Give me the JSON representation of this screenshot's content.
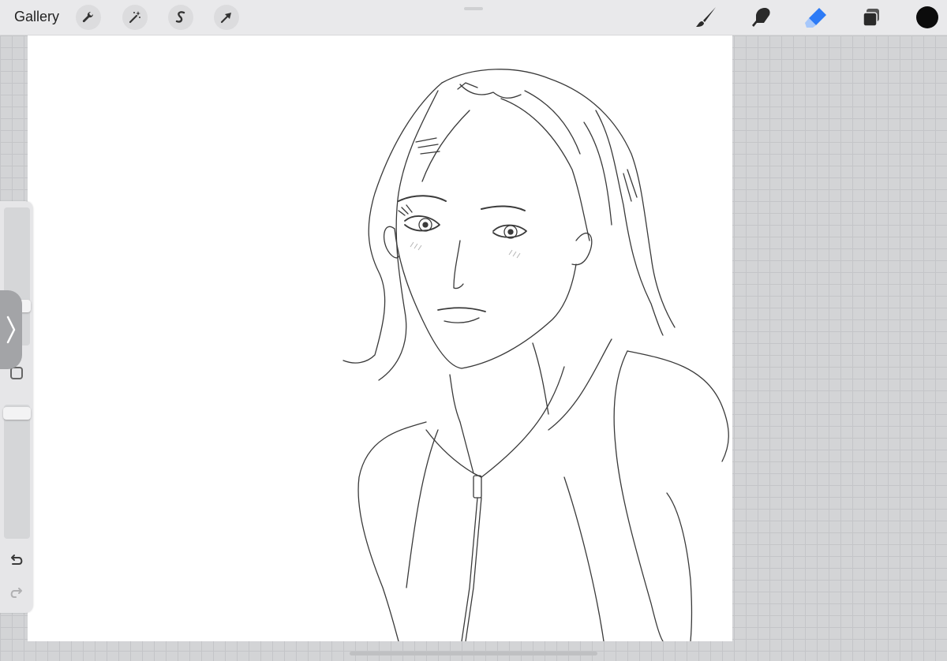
{
  "topbar": {
    "gallery_label": "Gallery"
  },
  "left_tools": [
    {
      "name": "actions",
      "icon": "wrench-icon"
    },
    {
      "name": "adjustments",
      "icon": "magic-wand-icon"
    },
    {
      "name": "selection",
      "icon": "selection-s-icon"
    },
    {
      "name": "transform",
      "icon": "arrow-cursor-icon"
    }
  ],
  "right_tools": [
    {
      "name": "brush",
      "icon": "brush-icon"
    },
    {
      "name": "smudge",
      "icon": "smudge-finger-icon"
    },
    {
      "name": "eraser",
      "icon": "eraser-icon",
      "active": true
    },
    {
      "name": "layers",
      "icon": "layers-icon"
    },
    {
      "name": "color",
      "icon": "color-swatch",
      "value": "#0c0c0c"
    }
  ],
  "sidebar": {
    "brush_size_level": 0.46,
    "opacity_level": 0.0,
    "expand_icon": "chevron-right-icon",
    "modify_icon": "square-icon",
    "undo_icon": "undo-icon",
    "redo_icon": "redo-icon"
  },
  "colors": {
    "accent": "#2d7bf6",
    "canvas": "#ffffff",
    "workspace": "#d3d4d6"
  }
}
